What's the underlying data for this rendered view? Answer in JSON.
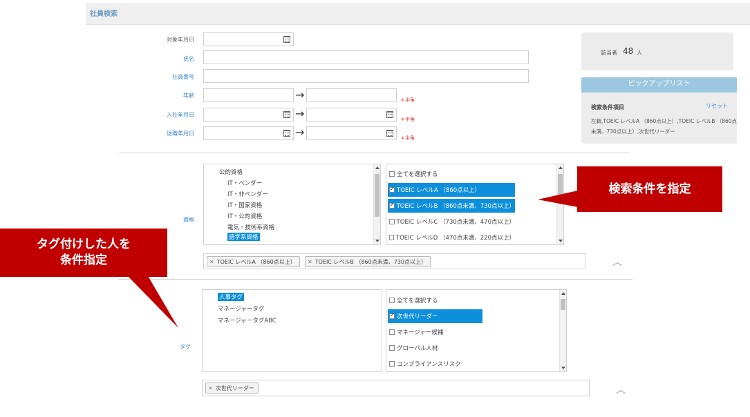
{
  "header": {
    "title": "社員検索"
  },
  "form": {
    "date_label": "対象年月日",
    "name_label": "氏名",
    "employee_no_label": "社員番号",
    "age_label": "年齢",
    "hire_date_label": "入社年月日",
    "retire_date_label": "退職年月日",
    "hankaku_note": "＊半角",
    "arrow": "→"
  },
  "summary": {
    "label": "該当者",
    "count": "48",
    "unit": "人"
  },
  "pickup": {
    "button_label": "ピックアップリスト",
    "conditions_title": "検索条件項目",
    "reset_label": "リセット",
    "conditions_text": "在籍,TOEIC レベルA （860点以上）,TOEIC レベルB （860点未満、730点以上）,次世代リーダー"
  },
  "qualifications": {
    "label": "資格",
    "tree": [
      "公的資格",
      "IT・ベンダー",
      "IT・非ベンダー",
      "IT・国家資格",
      "IT・公的資格",
      "電気・技術系資格",
      "語学系資格"
    ],
    "tree_selected": "語学系資格",
    "options": [
      {
        "label": "全てを選択する",
        "checked": false
      },
      {
        "label": "TOEIC レベルA （860点以上）",
        "checked": true
      },
      {
        "label": "TOEIC レベルB （860点未満、730点以上）",
        "checked": true
      },
      {
        "label": "TOEIC レベルC （730点未満、470点以上）",
        "checked": false
      },
      {
        "label": "TOEIC レベルD （470点未満、220点以上）",
        "checked": false
      }
    ],
    "chips": [
      "TOEIC レベルA （860点以上）",
      "TOEIC レベルB （860点未満、730点以上）"
    ]
  },
  "tags": {
    "label": "タグ",
    "tree": [
      "人事タグ",
      "マネージャータグ",
      "マネージャータグABC"
    ],
    "tree_selected": "人事タグ",
    "options": [
      {
        "label": "全てを選択する",
        "checked": false
      },
      {
        "label": "次世代リーダー",
        "checked": true
      },
      {
        "label": "マネージャー候補",
        "checked": false
      },
      {
        "label": "グローバル人材",
        "checked": false
      },
      {
        "label": "コンプライアンスリスク",
        "checked": false
      }
    ],
    "chips": [
      "次世代リーダー"
    ]
  },
  "callouts": {
    "right": "検索条件を指定",
    "left_line1": "タグ付けした人を",
    "left_line2": "条件指定"
  },
  "icons": {
    "calendar": "calendar-icon",
    "arrow": "arrow-right-icon",
    "collapse": "chevron-up-icon",
    "remove": "close-icon"
  },
  "colors": {
    "accent": "#0e8fdb",
    "callout": "#c00000",
    "pickup": "#9bc7e1",
    "header_title": "#6d9ec4"
  }
}
